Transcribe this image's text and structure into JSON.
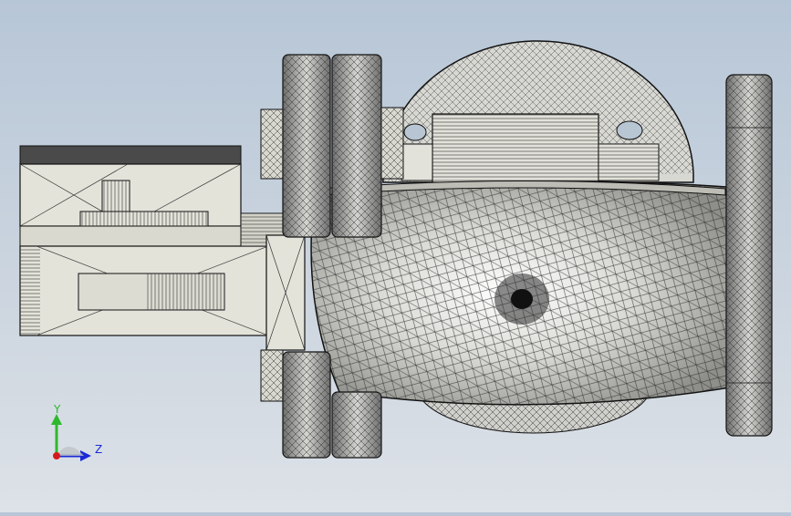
{
  "viewport": {
    "background_top": "#b7c6d7",
    "background_bottom": "#dde2e8",
    "model_body_color": "#e3e3da",
    "mesh_line_color": "#2a2a2a"
  },
  "triad": {
    "y_label": "Y",
    "z_label": "Z",
    "y_color": "#2fb82f",
    "z_color": "#1a2ad6",
    "x_color": "#d61a1a"
  }
}
